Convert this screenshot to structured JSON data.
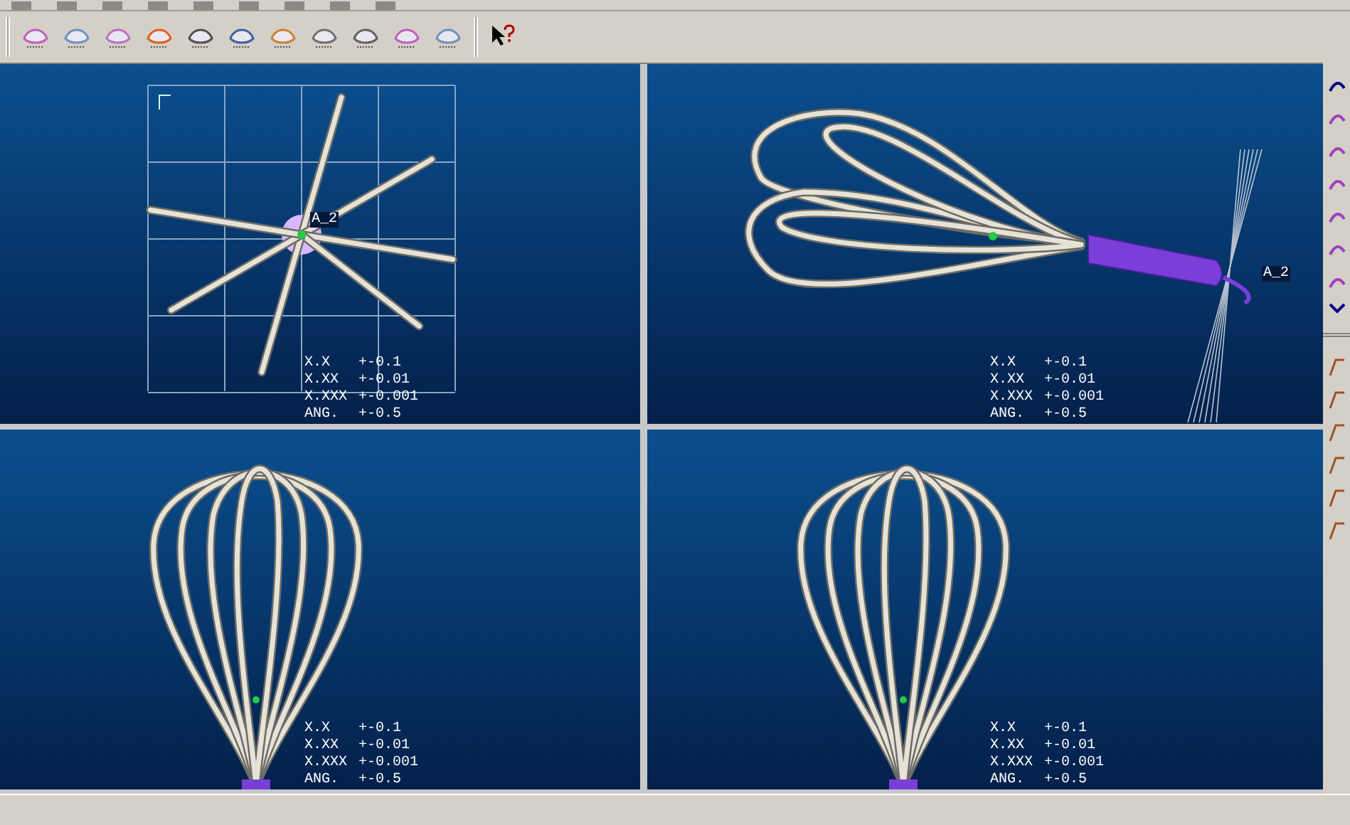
{
  "viewports": [
    {
      "kind": "top",
      "datum_label": "A_2",
      "tolerances": [
        {
          "label": "X.X",
          "value": "+-0.1"
        },
        {
          "label": "X.XX",
          "value": "+-0.01"
        },
        {
          "label": "X.XXX",
          "value": "+-0.001"
        },
        {
          "label": "ANG.",
          "value": "+-0.5"
        }
      ]
    },
    {
      "kind": "side",
      "datum_label": "A_2",
      "tolerances": [
        {
          "label": "X.X",
          "value": "+-0.1"
        },
        {
          "label": "X.XX",
          "value": "+-0.01"
        },
        {
          "label": "X.XXX",
          "value": "+-0.001"
        },
        {
          "label": "ANG.",
          "value": "+-0.5"
        }
      ]
    },
    {
      "kind": "front",
      "tolerances": [
        {
          "label": "X.X",
          "value": "+-0.1"
        },
        {
          "label": "X.XX",
          "value": "+-0.01"
        },
        {
          "label": "X.XXX",
          "value": "+-0.001"
        },
        {
          "label": "ANG.",
          "value": "+-0.5"
        }
      ]
    },
    {
      "kind": "front",
      "tolerances": [
        {
          "label": "X.X",
          "value": "+-0.1"
        },
        {
          "label": "X.XX",
          "value": "+-0.01"
        },
        {
          "label": "X.XXX",
          "value": "+-0.001"
        },
        {
          "label": "ANG.",
          "value": "+-0.5"
        }
      ]
    }
  ]
}
